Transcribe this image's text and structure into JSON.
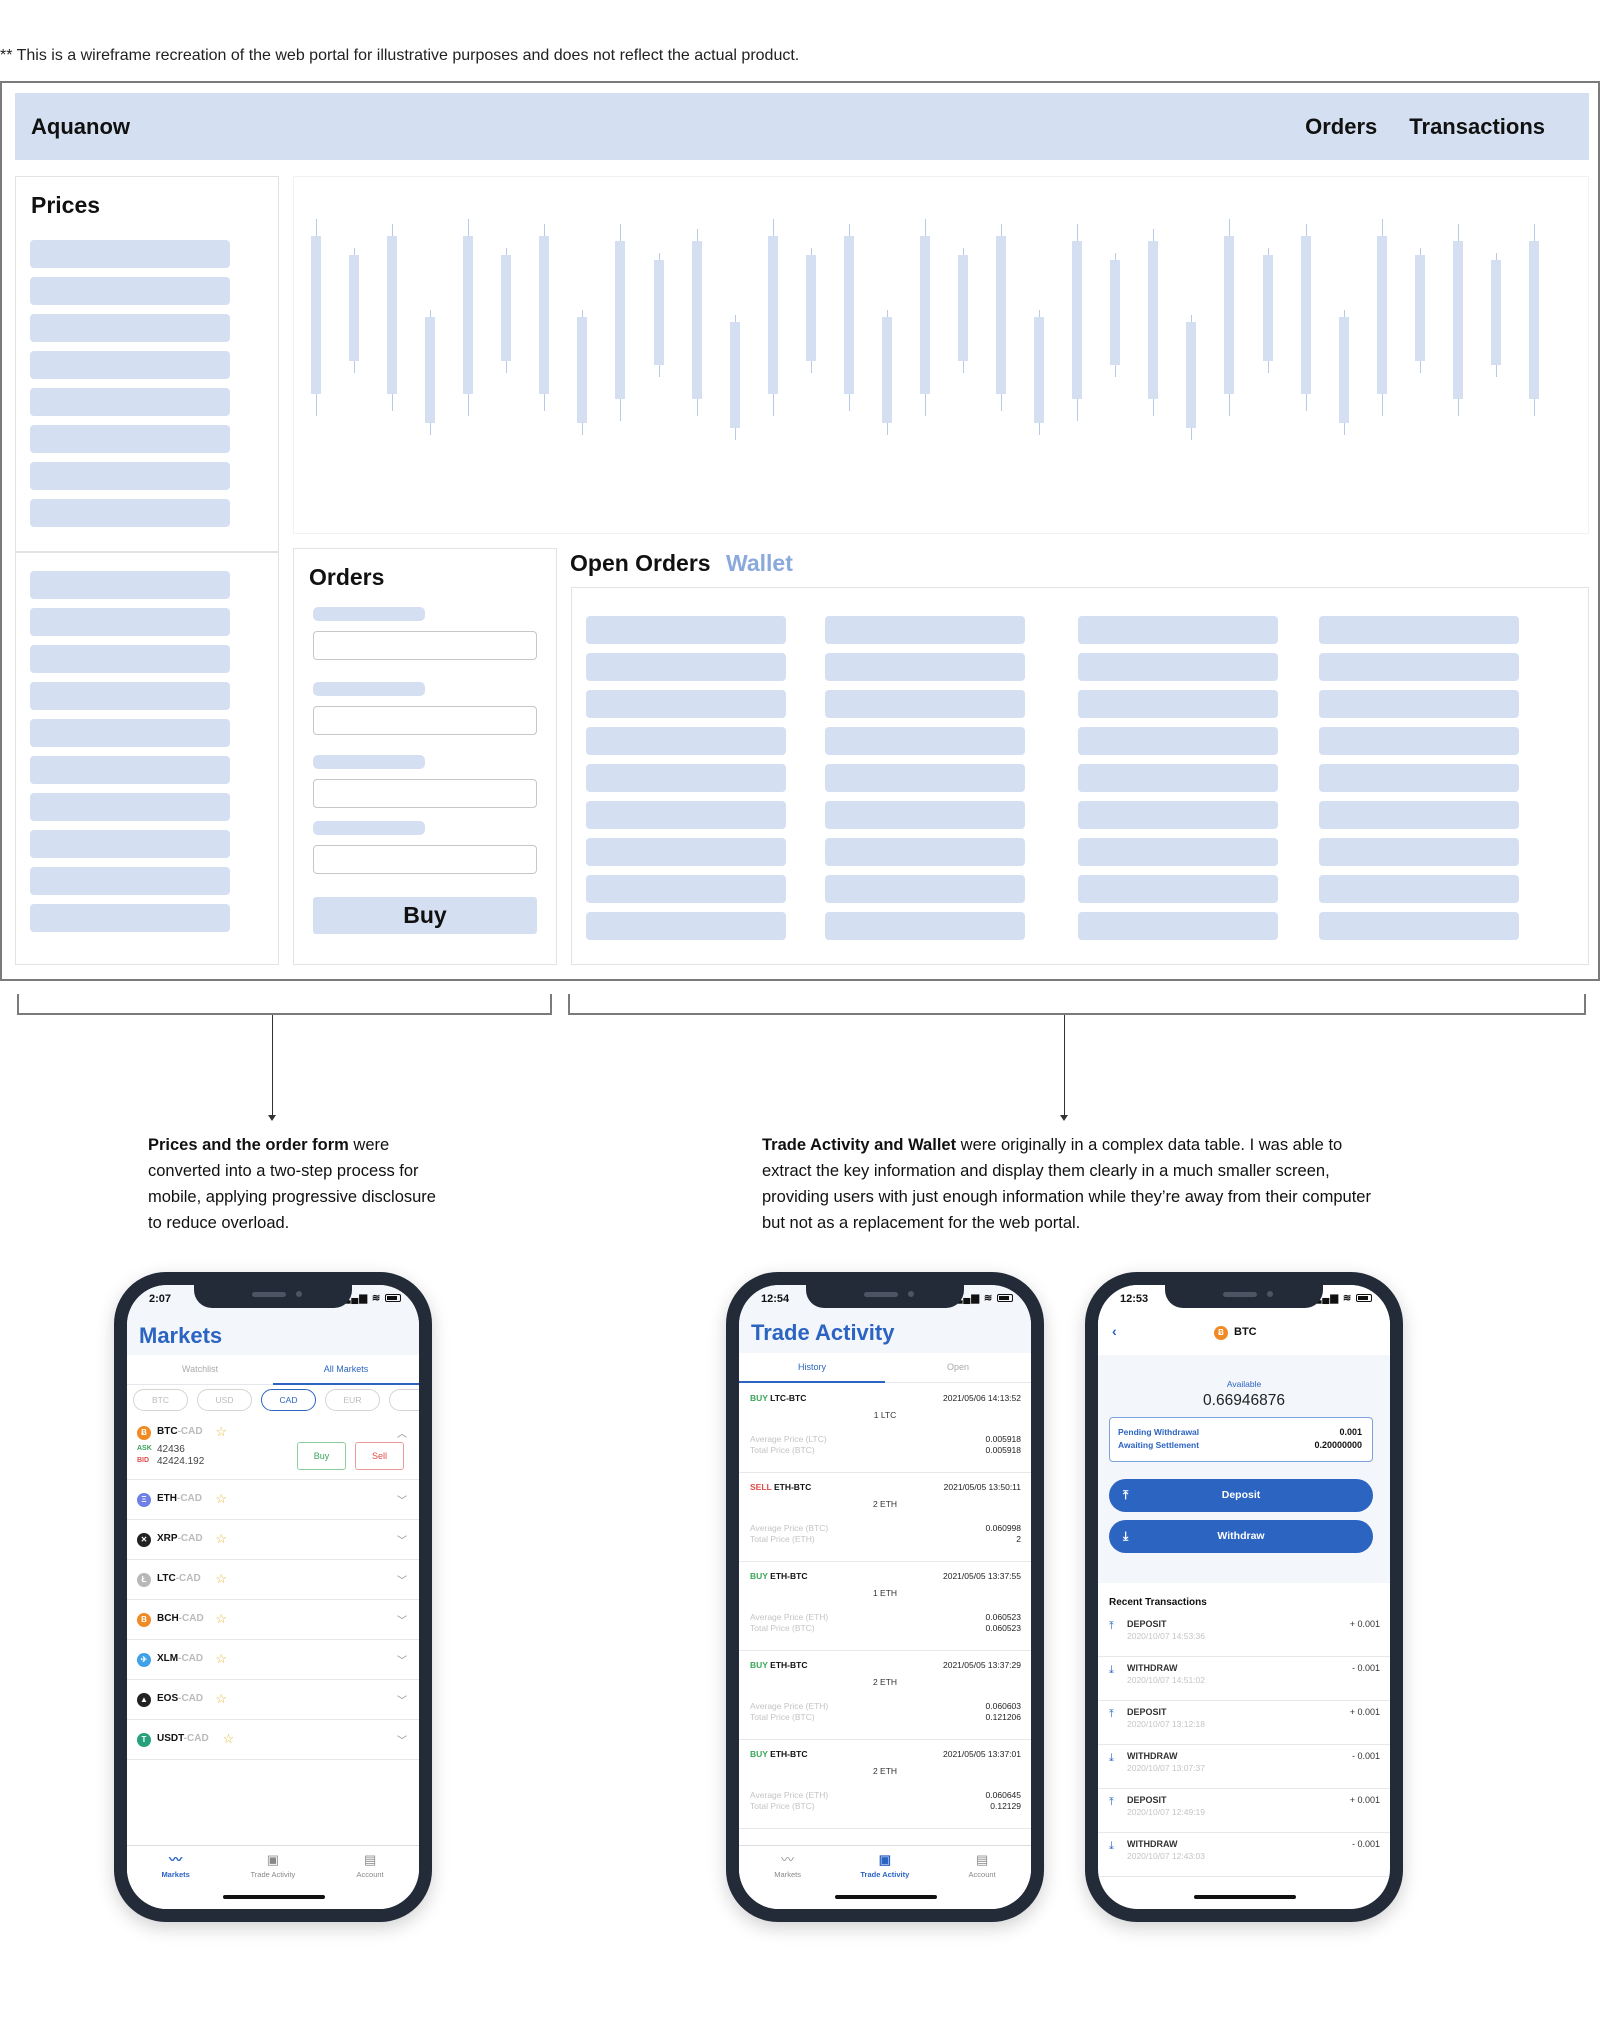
{
  "disclaimer": "** This is a wireframe recreation of the web portal for illustrative purposes and does not reflect the actual product.",
  "portal": {
    "brand": "Aquanow",
    "nav": [
      "Orders",
      "Transactions"
    ],
    "prices_title": "Prices",
    "orders_title": "Orders",
    "buy_label": "Buy",
    "tabs": {
      "open_orders": "Open Orders",
      "wallet": "Wallet"
    },
    "colors": {
      "skeleton": "#d4e0f1",
      "accent": "#8aa9dc",
      "border": "#7b7b7b"
    }
  },
  "candles": [
    {
      "high": 0.95,
      "open": 0.88,
      "close": 0.22,
      "low": 0.13
    },
    {
      "high": 0.83,
      "open": 0.8,
      "close": 0.36,
      "low": 0.31
    },
    {
      "high": 0.93,
      "open": 0.88,
      "close": 0.22,
      "low": 0.15
    },
    {
      "high": 0.57,
      "open": 0.54,
      "close": 0.1,
      "low": 0.05
    },
    {
      "high": 0.95,
      "open": 0.88,
      "close": 0.22,
      "low": 0.13
    },
    {
      "high": 0.83,
      "open": 0.8,
      "close": 0.36,
      "low": 0.31
    },
    {
      "high": 0.93,
      "open": 0.88,
      "close": 0.22,
      "low": 0.15
    },
    {
      "high": 0.57,
      "open": 0.54,
      "close": 0.1,
      "low": 0.05
    },
    {
      "high": 0.93,
      "open": 0.86,
      "close": 0.2,
      "low": 0.11
    },
    {
      "high": 0.81,
      "open": 0.78,
      "close": 0.34,
      "low": 0.29
    },
    {
      "high": 0.91,
      "open": 0.86,
      "close": 0.2,
      "low": 0.13
    },
    {
      "high": 0.55,
      "open": 0.52,
      "close": 0.08,
      "low": 0.03
    },
    {
      "high": 0.95,
      "open": 0.88,
      "close": 0.22,
      "low": 0.13
    },
    {
      "high": 0.83,
      "open": 0.8,
      "close": 0.36,
      "low": 0.31
    },
    {
      "high": 0.93,
      "open": 0.88,
      "close": 0.22,
      "low": 0.15
    },
    {
      "high": 0.57,
      "open": 0.54,
      "close": 0.1,
      "low": 0.05
    },
    {
      "high": 0.95,
      "open": 0.88,
      "close": 0.22,
      "low": 0.13
    },
    {
      "high": 0.83,
      "open": 0.8,
      "close": 0.36,
      "low": 0.31
    },
    {
      "high": 0.93,
      "open": 0.88,
      "close": 0.22,
      "low": 0.15
    },
    {
      "high": 0.57,
      "open": 0.54,
      "close": 0.1,
      "low": 0.05
    },
    {
      "high": 0.93,
      "open": 0.86,
      "close": 0.2,
      "low": 0.11
    },
    {
      "high": 0.81,
      "open": 0.78,
      "close": 0.34,
      "low": 0.29
    },
    {
      "high": 0.91,
      "open": 0.86,
      "close": 0.2,
      "low": 0.13
    },
    {
      "high": 0.55,
      "open": 0.52,
      "close": 0.08,
      "low": 0.03
    },
    {
      "high": 0.95,
      "open": 0.88,
      "close": 0.22,
      "low": 0.13
    },
    {
      "high": 0.83,
      "open": 0.8,
      "close": 0.36,
      "low": 0.31
    },
    {
      "high": 0.93,
      "open": 0.88,
      "close": 0.22,
      "low": 0.15
    },
    {
      "high": 0.57,
      "open": 0.54,
      "close": 0.1,
      "low": 0.05
    },
    {
      "high": 0.95,
      "open": 0.88,
      "close": 0.22,
      "low": 0.13
    },
    {
      "high": 0.83,
      "open": 0.8,
      "close": 0.36,
      "low": 0.31
    },
    {
      "high": 0.93,
      "open": 0.86,
      "close": 0.2,
      "low": 0.13
    },
    {
      "high": 0.81,
      "open": 0.78,
      "close": 0.34,
      "low": 0.29
    },
    {
      "high": 0.93,
      "open": 0.86,
      "close": 0.2,
      "low": 0.13
    }
  ],
  "captions": {
    "left_bold": "Prices and the order form",
    "left_rest": " were converted into a two-step process for mobile, applying progressive disclosure to reduce overload.",
    "right_bold": "Trade Activity and Wallet",
    "right_rest": " were originally in a complex data table. I was able to extract the key information and display them clearly in a much smaller screen, providing users with just enough information while they’re away from their computer but not as a replacement for the web portal."
  },
  "markets_phone": {
    "time": "2:07",
    "title": "Markets",
    "tabs": [
      "Watchlist",
      "All Markets"
    ],
    "chips": [
      "BTC",
      "USD",
      "CAD",
      "EUR"
    ],
    "active_chip": "CAD",
    "rows": [
      {
        "base": "BTC",
        "quote": "-CAD",
        "icon": "bitcoin-icon",
        "glyph": "Ƀ",
        "color": "#f08a24",
        "expanded": true
      },
      {
        "base": "ETH",
        "quote": "-CAD",
        "icon": "ethereum-icon",
        "glyph": "Ξ",
        "color": "#6f7fe6"
      },
      {
        "base": "XRP",
        "quote": "-CAD",
        "icon": "xrp-icon",
        "glyph": "✕",
        "color": "#222"
      },
      {
        "base": "LTC",
        "quote": "-CAD",
        "icon": "litecoin-icon",
        "glyph": "Ł",
        "color": "#b8b8b8"
      },
      {
        "base": "BCH",
        "quote": "-CAD",
        "icon": "bitcoin-cash-icon",
        "glyph": "B",
        "color": "#f08a24"
      },
      {
        "base": "XLM",
        "quote": "-CAD",
        "icon": "stellar-icon",
        "glyph": "✈",
        "color": "#3fa2e8"
      },
      {
        "base": "EOS",
        "quote": "-CAD",
        "icon": "eos-icon",
        "glyph": "▲",
        "color": "#222"
      },
      {
        "base": "USDT",
        "quote": "-CAD",
        "icon": "tether-icon",
        "glyph": "T",
        "color": "#26a17b"
      }
    ],
    "btc_detail": {
      "ask_label": "ASK",
      "ask": "42436",
      "bid_label": "BID",
      "bid": "42424.192",
      "buy": "Buy",
      "sell": "Sell"
    },
    "bottom_nav": [
      "Markets",
      "Trade Activity",
      "Account"
    ],
    "active_nav": "Markets"
  },
  "trade_phone": {
    "time": "12:54",
    "title": "Trade Activity",
    "tabs": [
      "History",
      "Open"
    ],
    "trades": [
      {
        "side": "BUY",
        "pair": "LTC-BTC",
        "date": "2021/05/06 14:13:52",
        "qty": "1 LTC",
        "avg_label": "Average Price (LTC)",
        "avg": "0.005918",
        "total_label": "Total Price (BTC)",
        "total": "0.005918"
      },
      {
        "side": "SELL",
        "pair": "ETH-BTC",
        "date": "2021/05/05 13:50:11",
        "qty": "2 ETH",
        "avg_label": "Average Price (BTC)",
        "avg": "0.060998",
        "total_label": "Total Price (ETH)",
        "total": "2"
      },
      {
        "side": "BUY",
        "pair": "ETH-BTC",
        "date": "2021/05/05 13:37:55",
        "qty": "1 ETH",
        "avg_label": "Average Price (ETH)",
        "avg": "0.060523",
        "total_label": "Total Price (BTC)",
        "total": "0.060523"
      },
      {
        "side": "BUY",
        "pair": "ETH-BTC",
        "date": "2021/05/05 13:37:29",
        "qty": "2 ETH",
        "avg_label": "Average Price (ETH)",
        "avg": "0.060603",
        "total_label": "Total Price (BTC)",
        "total": "0.121206"
      },
      {
        "side": "BUY",
        "pair": "ETH-BTC",
        "date": "2021/05/05 13:37:01",
        "qty": "2 ETH",
        "avg_label": "Average Price (ETH)",
        "avg": "0.060645",
        "total_label": "Total Price (BTC)",
        "total": "0.12129"
      }
    ],
    "colors": {
      "buy": "#3aa65a",
      "sell": "#e04b4b"
    },
    "bottom_nav": [
      "Markets",
      "Trade Activity",
      "Account"
    ],
    "active_nav": "Trade Activity"
  },
  "wallet_phone": {
    "time": "12:53",
    "coin": "BTC",
    "available_label": "Available",
    "available": "0.66946876",
    "pending_label": "Pending Withdrawal",
    "pending": "0.001",
    "awaiting_label": "Awaiting Settlement",
    "awaiting": "0.20000000",
    "deposit": "Deposit",
    "withdraw": "Withdraw",
    "recent_title": "Recent Transactions",
    "transactions": [
      {
        "type": "DEPOSIT",
        "date": "2020/10/07 14:53:36",
        "amount": "+ 0.001"
      },
      {
        "type": "WITHDRAW",
        "date": "2020/10/07 14:51:02",
        "amount": "- 0.001"
      },
      {
        "type": "DEPOSIT",
        "date": "2020/10/07 13:12:18",
        "amount": "+ 0.001"
      },
      {
        "type": "WITHDRAW",
        "date": "2020/10/07 13:07:37",
        "amount": "- 0.001"
      },
      {
        "type": "DEPOSIT",
        "date": "2020/10/07 12:49:19",
        "amount": "+ 0.001"
      },
      {
        "type": "WITHDRAW",
        "date": "2020/10/07 12:43:03",
        "amount": "- 0.001"
      }
    ]
  }
}
